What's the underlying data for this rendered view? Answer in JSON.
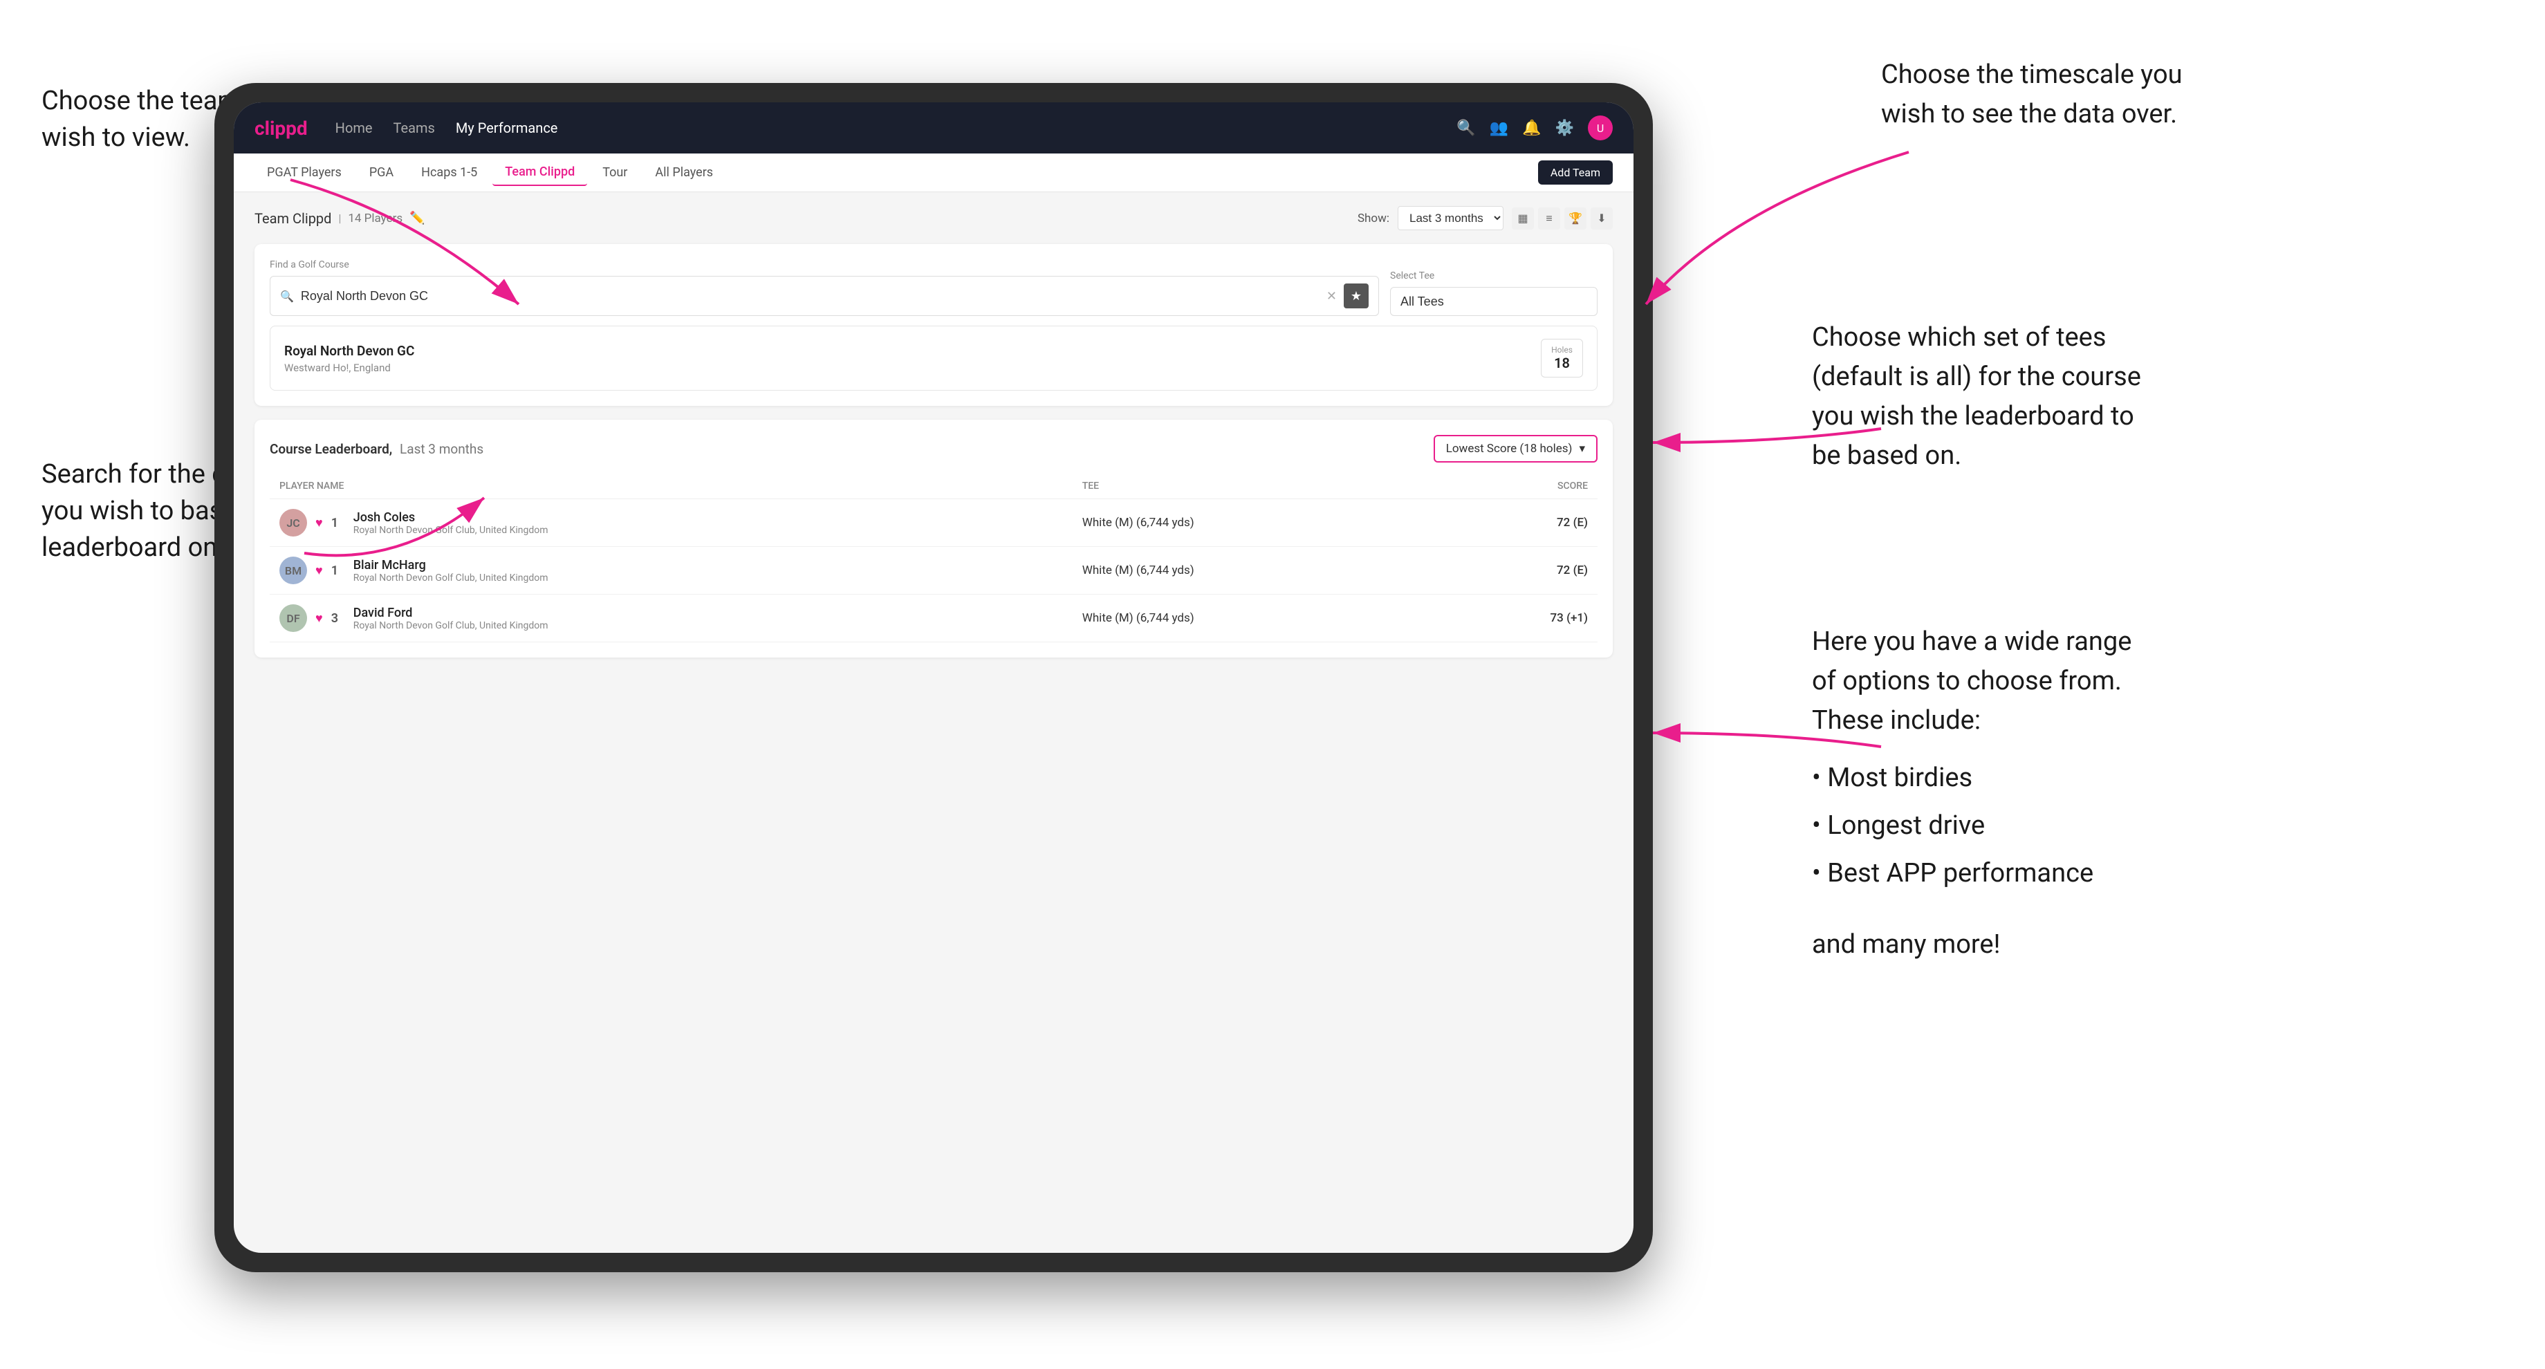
{
  "annotations": {
    "top_left": {
      "line1": "Choose the team you",
      "line2": "wish to view."
    },
    "middle_left": {
      "line1": "Search for the course",
      "line2": "you wish to base the",
      "line3": "leaderboard on."
    },
    "top_right": {
      "line1": "Choose the timescale you",
      "line2": "wish to see the data over."
    },
    "middle_right": {
      "line1": "Choose which set of tees",
      "line2": "(default is all) for the course",
      "line3": "you wish the leaderboard to",
      "line4": "be based on."
    },
    "bottom_right": {
      "intro": "Here you have a wide range",
      "line2": "of options to choose from.",
      "line3": "These include:",
      "bullets": [
        "Most birdies",
        "Longest drive",
        "Best APP performance"
      ],
      "footer": "and many more!"
    }
  },
  "nav": {
    "logo": "clippd",
    "links": [
      "Home",
      "Teams",
      "My Performance"
    ],
    "active_link": "My Performance",
    "icons": [
      "search",
      "users",
      "bell",
      "settings",
      "avatar"
    ]
  },
  "sub_nav": {
    "items": [
      "PGAT Players",
      "PGA",
      "Hcaps 1-5",
      "Team Clippd",
      "Tour",
      "All Players"
    ],
    "active": "Team Clippd",
    "add_button": "Add Team"
  },
  "team_header": {
    "title": "Team Clippd",
    "player_count": "14 Players",
    "show_label": "Show:",
    "show_value": "Last 3 months"
  },
  "course_search": {
    "find_label": "Find a Golf Course",
    "search_value": "Royal North Devon GC",
    "select_tee_label": "Select Tee",
    "tee_value": "All Tees"
  },
  "course_result": {
    "name": "Royal North Devon GC",
    "location": "Westward Ho!, England",
    "holes_label": "Holes",
    "holes_value": "18"
  },
  "leaderboard": {
    "title": "Course Leaderboard,",
    "period": "Last 3 months",
    "score_type": "Lowest Score (18 holes)",
    "columns": {
      "player_name": "PLAYER NAME",
      "tee": "TEE",
      "score": "SCORE"
    },
    "players": [
      {
        "rank": "1",
        "name": "Josh Coles",
        "club": "Royal North Devon Golf Club, United Kingdom",
        "tee": "White (M) (6,744 yds)",
        "score": "72 (E)"
      },
      {
        "rank": "1",
        "name": "Blair McHarg",
        "club": "Royal North Devon Golf Club, United Kingdom",
        "tee": "White (M) (6,744 yds)",
        "score": "72 (E)"
      },
      {
        "rank": "3",
        "name": "David Ford",
        "club": "Royal North Devon Golf Club, United Kingdom",
        "tee": "White (M) (6,744 yds)",
        "score": "73 (+1)"
      }
    ]
  }
}
